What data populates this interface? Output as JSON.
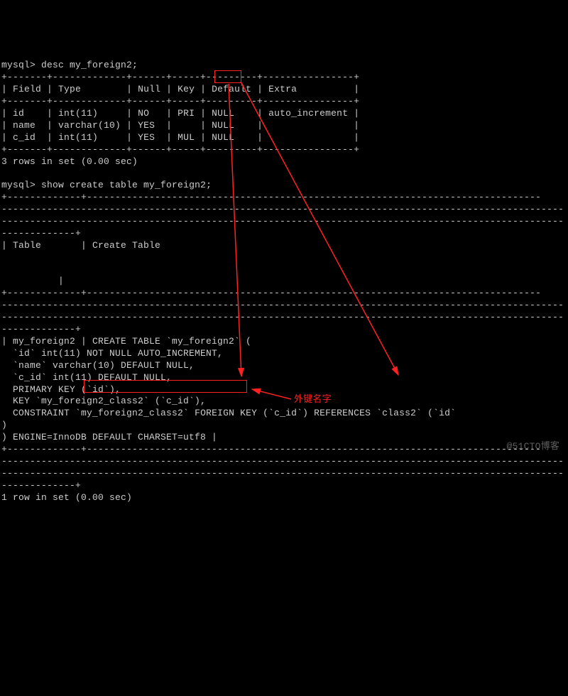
{
  "prompt": "mysql>",
  "cmd1": "desc my_foreign2;",
  "header": {
    "field": "Field",
    "type": "Type",
    "null": "Null",
    "key": "Key",
    "default": "Default",
    "extra": "Extra"
  },
  "rows": [
    {
      "field": "id",
      "type": "int(11)",
      "null": "NO",
      "key": "PRI",
      "default": "NULL",
      "extra": "auto_increment"
    },
    {
      "field": "name",
      "type": "varchar(10)",
      "null": "YES",
      "key": "",
      "default": "NULL",
      "extra": ""
    },
    {
      "field": "c_id",
      "type": "int(11)",
      "null": "YES",
      "key": "MUL",
      "default": "NULL",
      "extra": ""
    }
  ],
  "result1": "3 rows in set (0.00 sec)",
  "cmd2": "show create table my_foreign2;",
  "ctHeader": {
    "table": "Table",
    "ct": "Create Table"
  },
  "create": {
    "l1": "| my_foreign2 | CREATE TABLE `my_foreign2` (",
    "l2": "  `id` int(11) NOT NULL AUTO_INCREMENT,",
    "l3": "  `name` varchar(10) DEFAULT NULL,",
    "l4": "  `c_id` int(11) DEFAULT NULL,",
    "l5": "  PRIMARY KEY (`id`),",
    "l6": "  KEY `my_foreign2_class2` (`c_id`),",
    "l7a": "  CONSTRAINT ",
    "l7b": "`my_foreign2_class2`",
    "l7c": " FOREIGN KEY (`c_id`) REFERENCES `class2` (`id`",
    "l8": ")",
    "l9": ") ENGINE=InnoDB DEFAULT CHARSET=utf8 |"
  },
  "result2": "1 row in set (0.00 sec)",
  "annotation": "外键名字",
  "watermark": "@51CTO博客",
  "highlights": {
    "mul_key": "MUL",
    "fk_name": "`my_foreign2_class2`"
  }
}
